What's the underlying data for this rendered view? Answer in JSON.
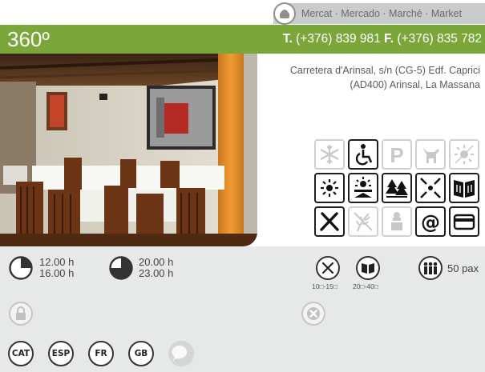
{
  "market": {
    "label": "Mercat · Mercado · Marché · Market",
    "icon": "basket-icon"
  },
  "header": {
    "title": "360º",
    "phone_prefix": "T.",
    "phone": "(+376) 839 981",
    "fax_prefix": "F.",
    "fax": "(+376) 835 782",
    "accent_color": "#7ba63a"
  },
  "address": {
    "line1": "Carretera d'Arinsal, s/n (CG-5) Edf. Caprici",
    "line2": "(AD400) Arinsal, La Massana"
  },
  "services": [
    {
      "icon": "air-conditioning-icon",
      "active": false
    },
    {
      "icon": "wheelchair-access-icon",
      "active": true
    },
    {
      "icon": "parking-icon",
      "active": false
    },
    {
      "icon": "pets-icon",
      "active": false
    },
    {
      "icon": "terrace-icon",
      "active": false
    },
    {
      "icon": "heating-icon",
      "active": true
    },
    {
      "icon": "sun-terrace-icon",
      "active": true
    },
    {
      "icon": "mountain-view-icon",
      "active": true
    },
    {
      "icon": "private-room-icon",
      "active": true
    },
    {
      "icon": "menu-book-icon",
      "active": true
    },
    {
      "icon": "restaurant-icon",
      "active": true
    },
    {
      "icon": "gluten-free-icon",
      "active": false
    },
    {
      "icon": "chef-icon",
      "active": false
    },
    {
      "icon": "email-icon",
      "active": true
    },
    {
      "icon": "credit-card-icon",
      "active": true
    }
  ],
  "schedule": {
    "lunch_open": "12.00 h",
    "lunch_close": "16.00 h",
    "dinner_open": "20.00 h",
    "dinner_close": "23.00 h"
  },
  "prices": {
    "menu_range": "10□-15□",
    "carte_range": "20□-40□"
  },
  "capacity": "50 pax",
  "languages": [
    "CAT",
    "ESP",
    "FR",
    "GB"
  ]
}
